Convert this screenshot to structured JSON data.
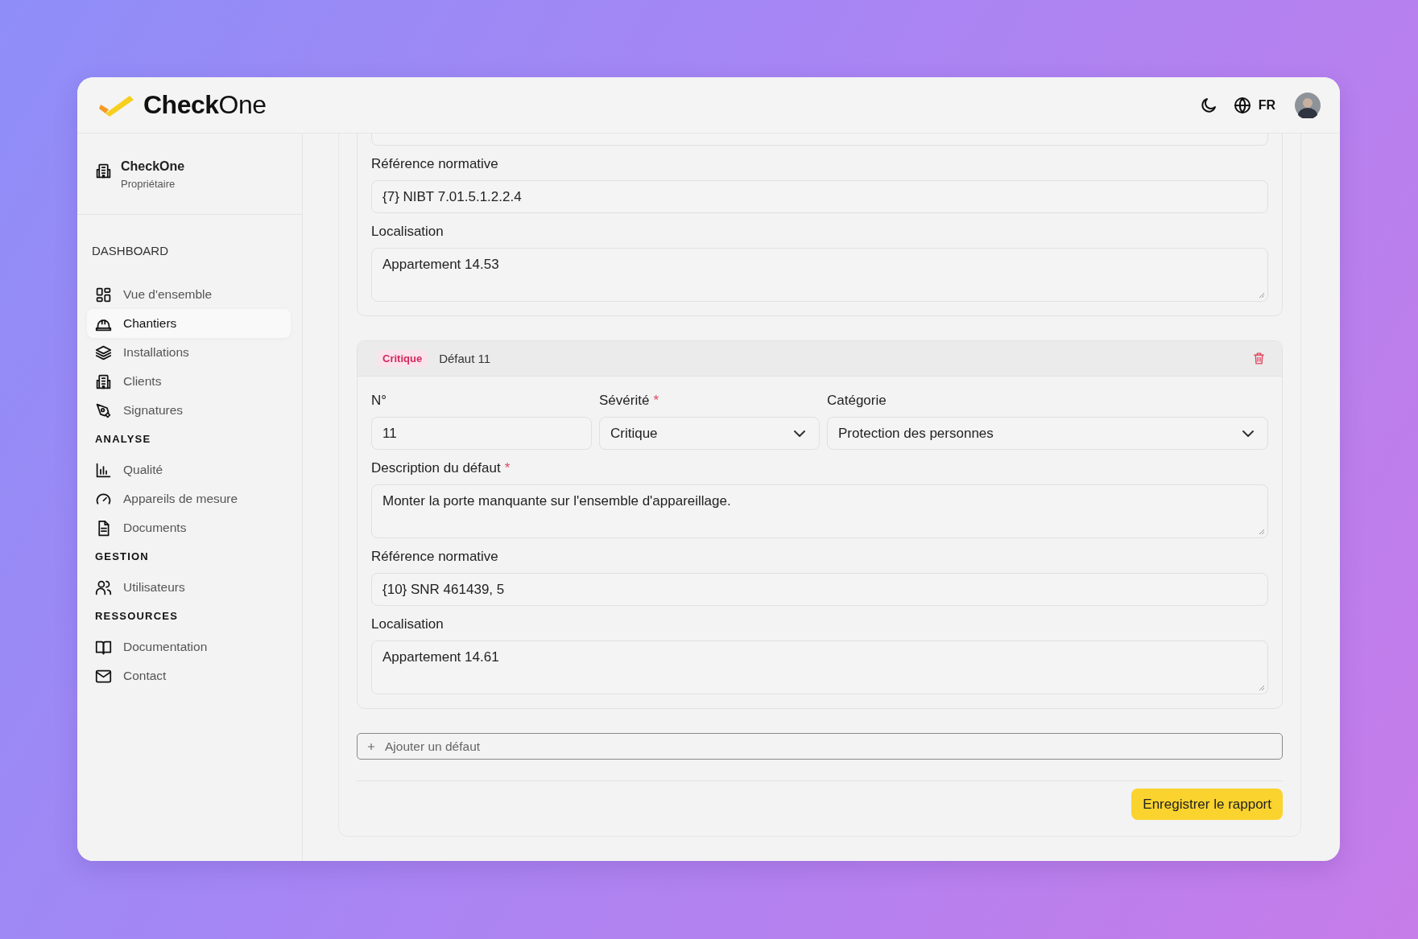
{
  "app": {
    "logo_text": "**Check**One"
  },
  "header": {
    "language": "FR"
  },
  "organization": {
    "name": "CheckOne",
    "role": "Propriétaire"
  },
  "sidebar": {
    "sections": [
      {
        "title": "DASHBOARD",
        "kind": "main",
        "items": [
          {
            "label": "Vue d'ensemble",
            "selected": false
          },
          {
            "label": "Chantiers",
            "selected": true
          },
          {
            "label": "Installations",
            "selected": false
          },
          {
            "label": "Clients",
            "selected": false
          },
          {
            "label": "Signatures",
            "selected": false
          }
        ]
      },
      {
        "title": "ANALYSE",
        "kind": "group",
        "items": [
          {
            "label": "Qualité",
            "selected": false
          },
          {
            "label": "Appareils de mesure",
            "selected": false
          },
          {
            "label": "Documents",
            "selected": false
          }
        ]
      },
      {
        "title": "GESTION",
        "kind": "group",
        "items": [
          {
            "label": "Utilisateurs",
            "selected": false
          }
        ]
      },
      {
        "title": "RESSOURCES",
        "kind": "group",
        "items": [
          {
            "label": "Documentation",
            "selected": false
          },
          {
            "label": "Contact",
            "selected": false
          }
        ]
      }
    ]
  },
  "defects": [
    {
      "kind": "partial",
      "fields": [
        {
          "label": "Référence normative",
          "value": "{7} NIBT 7.01.5.1.2.2.4",
          "kind": "input"
        },
        {
          "label": "Localisation",
          "value": "Appartement 14.53",
          "kind": "textarea"
        }
      ]
    },
    {
      "kind": "full",
      "badge": "Critique",
      "title": "Défaut 11",
      "row": [
        {
          "label": "N°",
          "value": "11",
          "kind": "input"
        },
        {
          "label": "Sévérité",
          "required_mark": "*",
          "value": "Critique",
          "kind": "select"
        },
        {
          "label": "Catégorie",
          "value": "Protection des personnes",
          "kind": "select"
        }
      ],
      "fields": [
        {
          "label": "Description du défaut",
          "required_mark": "*",
          "value": "Monter la porte manquante sur l'ensemble d'appareillage.",
          "kind": "textarea"
        },
        {
          "label": "Référence normative",
          "value": "{10} SNR 461439, 5",
          "kind": "input"
        },
        {
          "label": "Localisation",
          "value": "Appartement 14.61",
          "kind": "textarea"
        }
      ]
    }
  ],
  "add_button": "Ajouter un défaut",
  "save_button": "Enregistrer le rapport"
}
